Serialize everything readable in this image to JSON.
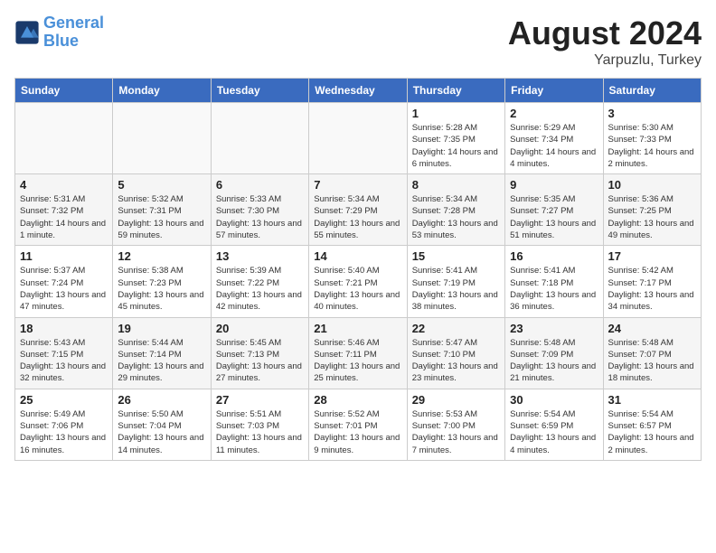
{
  "header": {
    "logo_line1": "General",
    "logo_line2": "Blue",
    "title": "August 2024",
    "subtitle": "Yarpuzlu, Turkey"
  },
  "days_of_week": [
    "Sunday",
    "Monday",
    "Tuesday",
    "Wednesday",
    "Thursday",
    "Friday",
    "Saturday"
  ],
  "weeks": [
    [
      {
        "day": "",
        "info": ""
      },
      {
        "day": "",
        "info": ""
      },
      {
        "day": "",
        "info": ""
      },
      {
        "day": "",
        "info": ""
      },
      {
        "day": "1",
        "info": "Sunrise: 5:28 AM\nSunset: 7:35 PM\nDaylight: 14 hours\nand 6 minutes."
      },
      {
        "day": "2",
        "info": "Sunrise: 5:29 AM\nSunset: 7:34 PM\nDaylight: 14 hours\nand 4 minutes."
      },
      {
        "day": "3",
        "info": "Sunrise: 5:30 AM\nSunset: 7:33 PM\nDaylight: 14 hours\nand 2 minutes."
      }
    ],
    [
      {
        "day": "4",
        "info": "Sunrise: 5:31 AM\nSunset: 7:32 PM\nDaylight: 14 hours\nand 1 minute."
      },
      {
        "day": "5",
        "info": "Sunrise: 5:32 AM\nSunset: 7:31 PM\nDaylight: 13 hours\nand 59 minutes."
      },
      {
        "day": "6",
        "info": "Sunrise: 5:33 AM\nSunset: 7:30 PM\nDaylight: 13 hours\nand 57 minutes."
      },
      {
        "day": "7",
        "info": "Sunrise: 5:34 AM\nSunset: 7:29 PM\nDaylight: 13 hours\nand 55 minutes."
      },
      {
        "day": "8",
        "info": "Sunrise: 5:34 AM\nSunset: 7:28 PM\nDaylight: 13 hours\nand 53 minutes."
      },
      {
        "day": "9",
        "info": "Sunrise: 5:35 AM\nSunset: 7:27 PM\nDaylight: 13 hours\nand 51 minutes."
      },
      {
        "day": "10",
        "info": "Sunrise: 5:36 AM\nSunset: 7:25 PM\nDaylight: 13 hours\nand 49 minutes."
      }
    ],
    [
      {
        "day": "11",
        "info": "Sunrise: 5:37 AM\nSunset: 7:24 PM\nDaylight: 13 hours\nand 47 minutes."
      },
      {
        "day": "12",
        "info": "Sunrise: 5:38 AM\nSunset: 7:23 PM\nDaylight: 13 hours\nand 45 minutes."
      },
      {
        "day": "13",
        "info": "Sunrise: 5:39 AM\nSunset: 7:22 PM\nDaylight: 13 hours\nand 42 minutes."
      },
      {
        "day": "14",
        "info": "Sunrise: 5:40 AM\nSunset: 7:21 PM\nDaylight: 13 hours\nand 40 minutes."
      },
      {
        "day": "15",
        "info": "Sunrise: 5:41 AM\nSunset: 7:19 PM\nDaylight: 13 hours\nand 38 minutes."
      },
      {
        "day": "16",
        "info": "Sunrise: 5:41 AM\nSunset: 7:18 PM\nDaylight: 13 hours\nand 36 minutes."
      },
      {
        "day": "17",
        "info": "Sunrise: 5:42 AM\nSunset: 7:17 PM\nDaylight: 13 hours\nand 34 minutes."
      }
    ],
    [
      {
        "day": "18",
        "info": "Sunrise: 5:43 AM\nSunset: 7:15 PM\nDaylight: 13 hours\nand 32 minutes."
      },
      {
        "day": "19",
        "info": "Sunrise: 5:44 AM\nSunset: 7:14 PM\nDaylight: 13 hours\nand 29 minutes."
      },
      {
        "day": "20",
        "info": "Sunrise: 5:45 AM\nSunset: 7:13 PM\nDaylight: 13 hours\nand 27 minutes."
      },
      {
        "day": "21",
        "info": "Sunrise: 5:46 AM\nSunset: 7:11 PM\nDaylight: 13 hours\nand 25 minutes."
      },
      {
        "day": "22",
        "info": "Sunrise: 5:47 AM\nSunset: 7:10 PM\nDaylight: 13 hours\nand 23 minutes."
      },
      {
        "day": "23",
        "info": "Sunrise: 5:48 AM\nSunset: 7:09 PM\nDaylight: 13 hours\nand 21 minutes."
      },
      {
        "day": "24",
        "info": "Sunrise: 5:48 AM\nSunset: 7:07 PM\nDaylight: 13 hours\nand 18 minutes."
      }
    ],
    [
      {
        "day": "25",
        "info": "Sunrise: 5:49 AM\nSunset: 7:06 PM\nDaylight: 13 hours\nand 16 minutes."
      },
      {
        "day": "26",
        "info": "Sunrise: 5:50 AM\nSunset: 7:04 PM\nDaylight: 13 hours\nand 14 minutes."
      },
      {
        "day": "27",
        "info": "Sunrise: 5:51 AM\nSunset: 7:03 PM\nDaylight: 13 hours\nand 11 minutes."
      },
      {
        "day": "28",
        "info": "Sunrise: 5:52 AM\nSunset: 7:01 PM\nDaylight: 13 hours\nand 9 minutes."
      },
      {
        "day": "29",
        "info": "Sunrise: 5:53 AM\nSunset: 7:00 PM\nDaylight: 13 hours\nand 7 minutes."
      },
      {
        "day": "30",
        "info": "Sunrise: 5:54 AM\nSunset: 6:59 PM\nDaylight: 13 hours\nand 4 minutes."
      },
      {
        "day": "31",
        "info": "Sunrise: 5:54 AM\nSunset: 6:57 PM\nDaylight: 13 hours\nand 2 minutes."
      }
    ]
  ]
}
